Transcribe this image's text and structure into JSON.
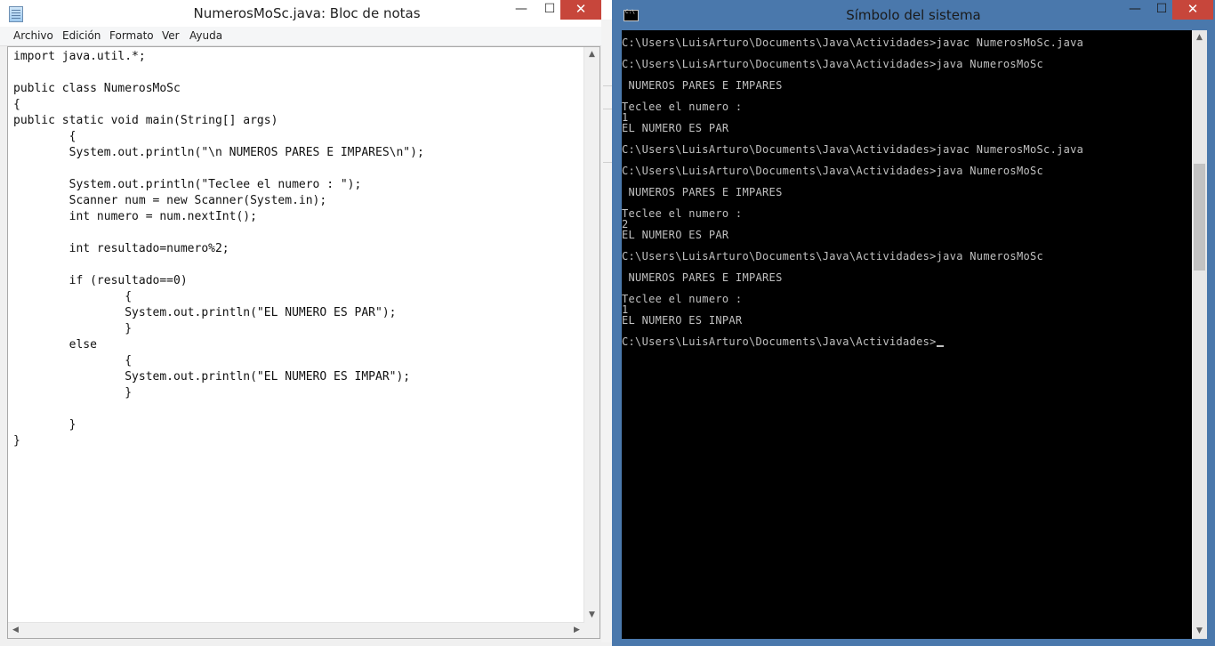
{
  "notepad": {
    "title": "NumerosMoSc.java: Bloc de notas",
    "menu": [
      "Archivo",
      "Edición",
      "Formato",
      "Ver",
      "Ayuda"
    ],
    "window_controls": {
      "minimize": "—",
      "maximize": "☐",
      "close": "✕"
    },
    "code": "import java.util.*;\n\npublic class NumerosMoSc\n{\npublic static void main(String[] args)\n        {\n        System.out.println(\"\\n NUMEROS PARES E IMPARES\\n\");\n\n        System.out.println(\"Teclee el numero : \");\n        Scanner num = new Scanner(System.in);\n        int numero = num.nextInt();\n\n        int resultado=numero%2;\n\n        if (resultado==0)\n                {\n                System.out.println(\"EL NUMERO ES PAR\");\n                }\n        else\n                {\n                System.out.println(\"EL NUMERO ES IMPAR\");\n                }\n\n        }\n}",
    "scroll_icons": {
      "up": "▲",
      "down": "▼",
      "left": "◀",
      "right": "▶"
    }
  },
  "cmd": {
    "title": "Símbolo del sistema",
    "window_controls": {
      "minimize": "—",
      "maximize": "☐",
      "close": "✕"
    },
    "output": "C:\\Users\\LuisArturo\\Documents\\Java\\Actividades>javac NumerosMoSc.java\n\nC:\\Users\\LuisArturo\\Documents\\Java\\Actividades>java NumerosMoSc\n\n NUMEROS PARES E IMPARES\n\nTeclee el numero :\n1\nEL NUMERO ES PAR\n\nC:\\Users\\LuisArturo\\Documents\\Java\\Actividades>javac NumerosMoSc.java\n\nC:\\Users\\LuisArturo\\Documents\\Java\\Actividades>java NumerosMoSc\n\n NUMEROS PARES E IMPARES\n\nTeclee el numero :\n2\nEL NUMERO ES PAR\n\nC:\\Users\\LuisArturo\\Documents\\Java\\Actividades>java NumerosMoSc\n\n NUMEROS PARES E IMPARES\n\nTeclee el numero :\n1\nEL NUMERO ES INPAR\n\nC:\\Users\\LuisArturo\\Documents\\Java\\Actividades>",
    "scroll_icons": {
      "up": "▲",
      "down": "▼"
    }
  },
  "colors": {
    "desktop": "#4a78ac",
    "close_button": "#c7463b",
    "console_bg": "#000000",
    "console_fg": "#c0c0c0"
  }
}
